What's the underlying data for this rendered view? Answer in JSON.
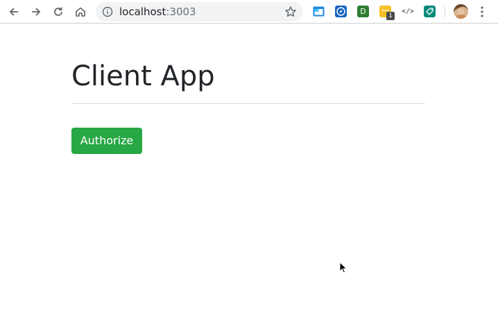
{
  "browser": {
    "back_icon": "arrow-left-icon",
    "forward_icon": "arrow-right-icon",
    "reload_icon": "reload-icon",
    "home_icon": "home-icon",
    "address_bar": {
      "info_icon": "info-icon",
      "host": "localhost",
      "port": ":3003",
      "bookmark_icon": "star-icon"
    },
    "extensions": [
      {
        "icon": "window-extension-icon",
        "color": "#1e88e5"
      },
      {
        "icon": "compass-extension-icon",
        "color": "#1565c0"
      },
      {
        "icon": "d-extension-icon",
        "label": "D",
        "color": "#2e7d32"
      },
      {
        "icon": "yellow-extension-icon",
        "badge": "1",
        "color": "#f6c026"
      },
      {
        "icon": "code-extension-icon",
        "label": "</>",
        "color": "#5f6368"
      },
      {
        "icon": "tag-extension-icon",
        "color": "#00897b"
      }
    ],
    "profile_icon": "profile-avatar",
    "menu_icon": "kebab-menu-icon"
  },
  "page": {
    "title": "Client App",
    "authorize_label": "Authorize",
    "accent_color": "#28a745"
  }
}
